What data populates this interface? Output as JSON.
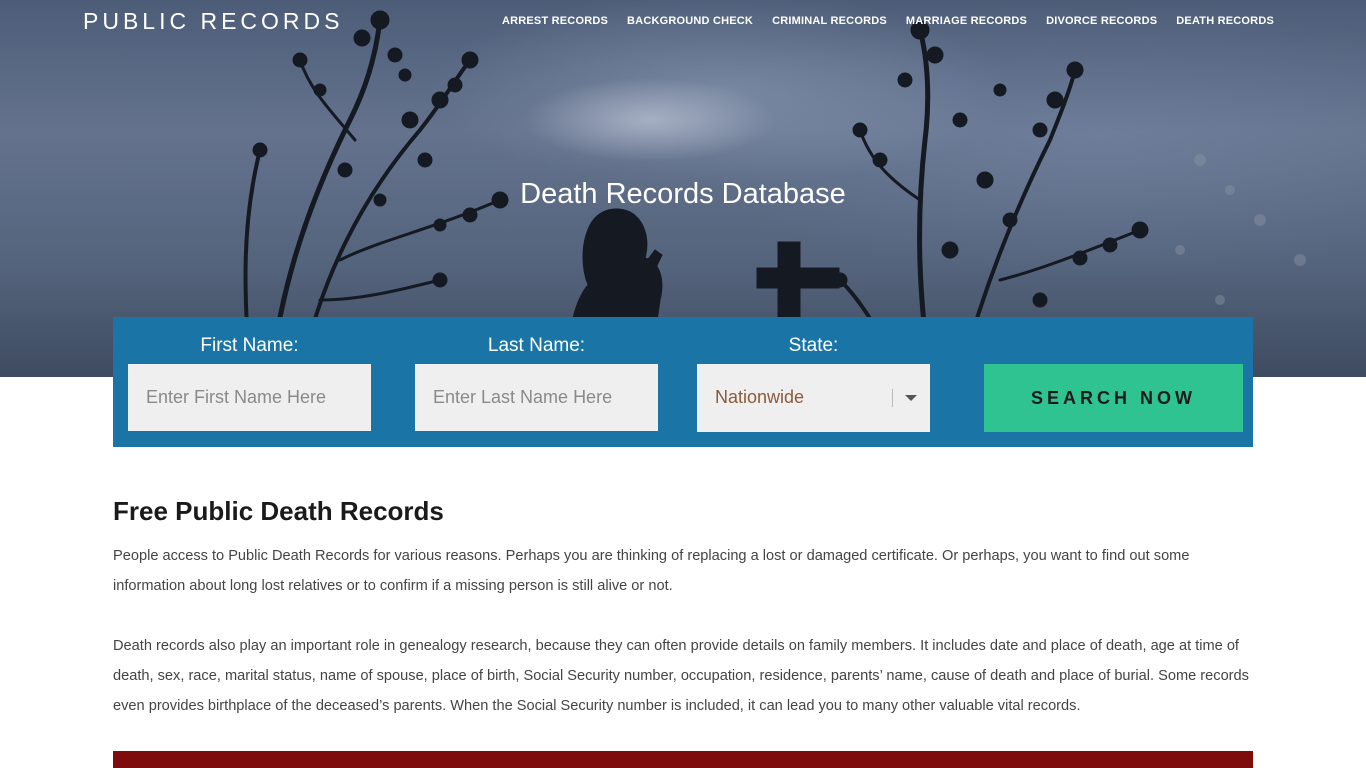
{
  "brand": "PUBLIC RECORDS",
  "nav": [
    "ARREST RECORDS",
    "BACKGROUND CHECK",
    "CRIMINAL RECORDS",
    "MARRIAGE RECORDS",
    "DIVORCE RECORDS",
    "DEATH RECORDS"
  ],
  "hero": {
    "title": "Death Records Database"
  },
  "search": {
    "first_label": "First Name:",
    "first_placeholder": "Enter First Name Here",
    "last_label": "Last Name:",
    "last_placeholder": "Enter Last Name Here",
    "state_label": "State:",
    "state_value": "Nationwide",
    "button_label": "SEARCH NOW"
  },
  "content": {
    "heading": "Free Public Death Records",
    "paragraphs": [
      "People access to Public Death Records for various reasons. Perhaps you are thinking of replacing a lost or damaged certificate. Or perhaps, you want to find out some information about long lost relatives or to confirm if a missing person is still alive or not.",
      "Death records also play an important role in genealogy research, because they can often provide details on family members. It includes date and place of death, age at time of death, sex, race, marital status, name of spouse, place of birth, Social Security number, occupation, residence, parents’ name, cause of death and place of burial. Some records even provides birthplace of the deceased’s parents. When the Social Security number is included, it can lead you to many other valuable vital records."
    ]
  },
  "colors": {
    "search_panel": "#1a75a6",
    "search_button": "#2ec391",
    "bottom_band": "#7e0c0c"
  }
}
